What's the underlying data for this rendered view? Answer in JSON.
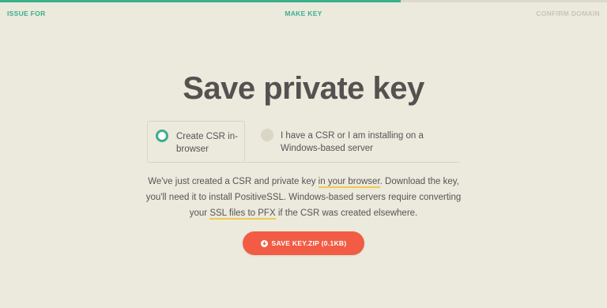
{
  "progress": {
    "fraction": 0.66,
    "fill_color": "#3ab08b",
    "track_color": "#dcd9cc"
  },
  "steps": [
    {
      "label": "ISSUE FOR",
      "state": "done"
    },
    {
      "label": "MAKE KEY",
      "state": "current"
    },
    {
      "label": "CONFIRM DOMAIN",
      "state": "upcoming"
    }
  ],
  "title": "Save private key",
  "options": [
    {
      "label": "Create CSR in-browser",
      "selected": true
    },
    {
      "label": "I have a CSR or I am installing on a Windows-based server",
      "selected": false
    }
  ],
  "description": {
    "part1": "We've just created a CSR and private key ",
    "link1": "in your browser",
    "part2": ". Download the key, you'll need it to install PositiveSSL. Windows-based servers require converting your ",
    "link2": "SSL files to PFX",
    "part3": " if the CSR was created elsewhere."
  },
  "save_button": {
    "label": "SAVE KEY.ZIP (0.1KB)",
    "icon": "download-icon",
    "color": "#f25c45"
  },
  "colors": {
    "background": "#ece9dd",
    "accent": "#3ab08b",
    "link_underline": "#f2c94c"
  }
}
